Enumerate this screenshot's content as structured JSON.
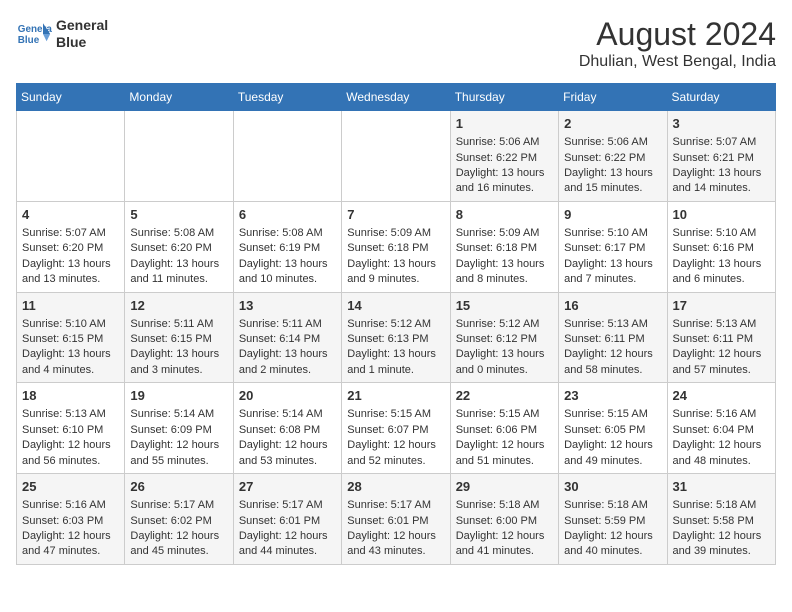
{
  "header": {
    "logo_line1": "General",
    "logo_line2": "Blue",
    "title": "August 2024",
    "subtitle": "Dhulian, West Bengal, India"
  },
  "days_of_week": [
    "Sunday",
    "Monday",
    "Tuesday",
    "Wednesday",
    "Thursday",
    "Friday",
    "Saturday"
  ],
  "weeks": [
    [
      {
        "day": "",
        "info": ""
      },
      {
        "day": "",
        "info": ""
      },
      {
        "day": "",
        "info": ""
      },
      {
        "day": "",
        "info": ""
      },
      {
        "day": "1",
        "info": "Sunrise: 5:06 AM\nSunset: 6:22 PM\nDaylight: 13 hours\nand 16 minutes."
      },
      {
        "day": "2",
        "info": "Sunrise: 5:06 AM\nSunset: 6:22 PM\nDaylight: 13 hours\nand 15 minutes."
      },
      {
        "day": "3",
        "info": "Sunrise: 5:07 AM\nSunset: 6:21 PM\nDaylight: 13 hours\nand 14 minutes."
      }
    ],
    [
      {
        "day": "4",
        "info": "Sunrise: 5:07 AM\nSunset: 6:20 PM\nDaylight: 13 hours\nand 13 minutes."
      },
      {
        "day": "5",
        "info": "Sunrise: 5:08 AM\nSunset: 6:20 PM\nDaylight: 13 hours\nand 11 minutes."
      },
      {
        "day": "6",
        "info": "Sunrise: 5:08 AM\nSunset: 6:19 PM\nDaylight: 13 hours\nand 10 minutes."
      },
      {
        "day": "7",
        "info": "Sunrise: 5:09 AM\nSunset: 6:18 PM\nDaylight: 13 hours\nand 9 minutes."
      },
      {
        "day": "8",
        "info": "Sunrise: 5:09 AM\nSunset: 6:18 PM\nDaylight: 13 hours\nand 8 minutes."
      },
      {
        "day": "9",
        "info": "Sunrise: 5:10 AM\nSunset: 6:17 PM\nDaylight: 13 hours\nand 7 minutes."
      },
      {
        "day": "10",
        "info": "Sunrise: 5:10 AM\nSunset: 6:16 PM\nDaylight: 13 hours\nand 6 minutes."
      }
    ],
    [
      {
        "day": "11",
        "info": "Sunrise: 5:10 AM\nSunset: 6:15 PM\nDaylight: 13 hours\nand 4 minutes."
      },
      {
        "day": "12",
        "info": "Sunrise: 5:11 AM\nSunset: 6:15 PM\nDaylight: 13 hours\nand 3 minutes."
      },
      {
        "day": "13",
        "info": "Sunrise: 5:11 AM\nSunset: 6:14 PM\nDaylight: 13 hours\nand 2 minutes."
      },
      {
        "day": "14",
        "info": "Sunrise: 5:12 AM\nSunset: 6:13 PM\nDaylight: 13 hours\nand 1 minute."
      },
      {
        "day": "15",
        "info": "Sunrise: 5:12 AM\nSunset: 6:12 PM\nDaylight: 13 hours\nand 0 minutes."
      },
      {
        "day": "16",
        "info": "Sunrise: 5:13 AM\nSunset: 6:11 PM\nDaylight: 12 hours\nand 58 minutes."
      },
      {
        "day": "17",
        "info": "Sunrise: 5:13 AM\nSunset: 6:11 PM\nDaylight: 12 hours\nand 57 minutes."
      }
    ],
    [
      {
        "day": "18",
        "info": "Sunrise: 5:13 AM\nSunset: 6:10 PM\nDaylight: 12 hours\nand 56 minutes."
      },
      {
        "day": "19",
        "info": "Sunrise: 5:14 AM\nSunset: 6:09 PM\nDaylight: 12 hours\nand 55 minutes."
      },
      {
        "day": "20",
        "info": "Sunrise: 5:14 AM\nSunset: 6:08 PM\nDaylight: 12 hours\nand 53 minutes."
      },
      {
        "day": "21",
        "info": "Sunrise: 5:15 AM\nSunset: 6:07 PM\nDaylight: 12 hours\nand 52 minutes."
      },
      {
        "day": "22",
        "info": "Sunrise: 5:15 AM\nSunset: 6:06 PM\nDaylight: 12 hours\nand 51 minutes."
      },
      {
        "day": "23",
        "info": "Sunrise: 5:15 AM\nSunset: 6:05 PM\nDaylight: 12 hours\nand 49 minutes."
      },
      {
        "day": "24",
        "info": "Sunrise: 5:16 AM\nSunset: 6:04 PM\nDaylight: 12 hours\nand 48 minutes."
      }
    ],
    [
      {
        "day": "25",
        "info": "Sunrise: 5:16 AM\nSunset: 6:03 PM\nDaylight: 12 hours\nand 47 minutes."
      },
      {
        "day": "26",
        "info": "Sunrise: 5:17 AM\nSunset: 6:02 PM\nDaylight: 12 hours\nand 45 minutes."
      },
      {
        "day": "27",
        "info": "Sunrise: 5:17 AM\nSunset: 6:01 PM\nDaylight: 12 hours\nand 44 minutes."
      },
      {
        "day": "28",
        "info": "Sunrise: 5:17 AM\nSunset: 6:01 PM\nDaylight: 12 hours\nand 43 minutes."
      },
      {
        "day": "29",
        "info": "Sunrise: 5:18 AM\nSunset: 6:00 PM\nDaylight: 12 hours\nand 41 minutes."
      },
      {
        "day": "30",
        "info": "Sunrise: 5:18 AM\nSunset: 5:59 PM\nDaylight: 12 hours\nand 40 minutes."
      },
      {
        "day": "31",
        "info": "Sunrise: 5:18 AM\nSunset: 5:58 PM\nDaylight: 12 hours\nand 39 minutes."
      }
    ]
  ]
}
